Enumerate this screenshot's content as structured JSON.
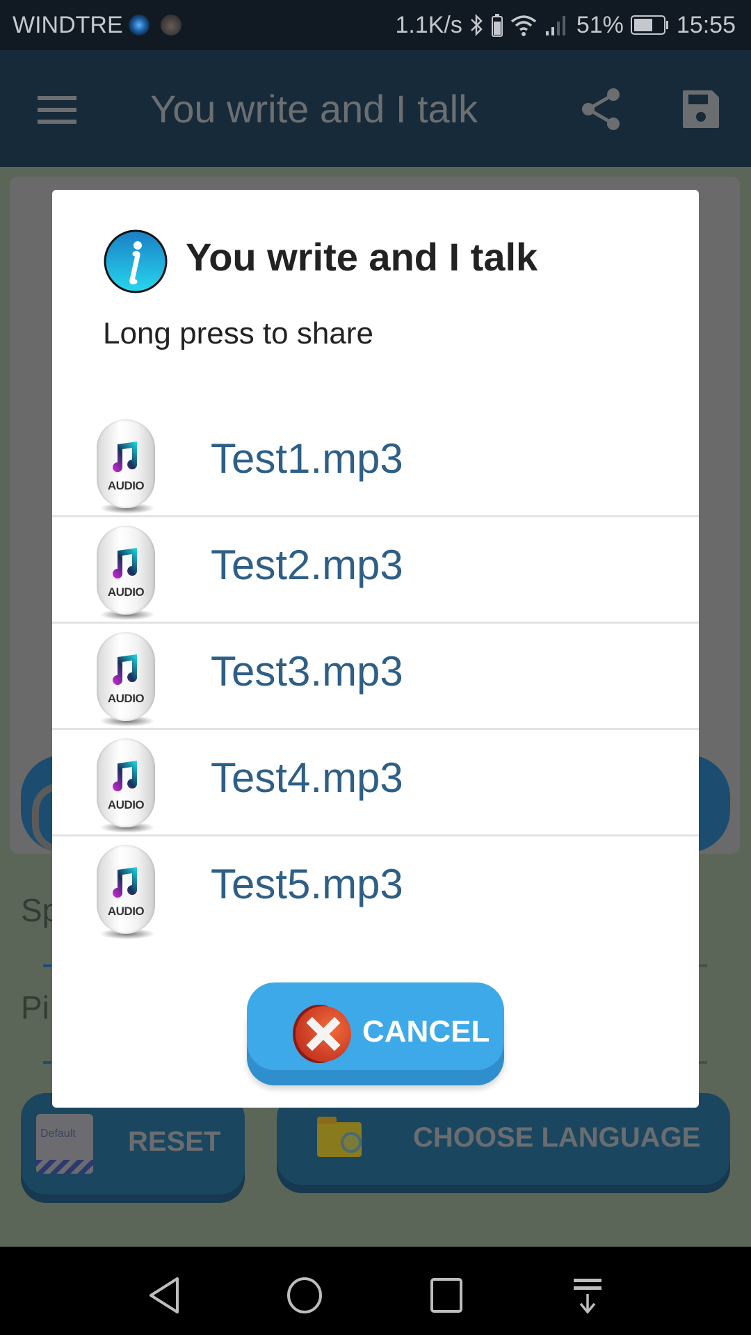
{
  "status_bar": {
    "carrier": "WINDTRE",
    "notification_icons": [
      "vpn-app-icon",
      "gorilla-app-icon"
    ],
    "network_speed": "1.1K/s",
    "battery_percent": "51%",
    "time": "15:55"
  },
  "app_bar": {
    "title": "You write and I talk",
    "icons": [
      "menu-icon",
      "share-icon",
      "save-icon"
    ]
  },
  "background": {
    "labels": [
      "Sp",
      "Pi"
    ],
    "reset_label": "RESET",
    "reset_icon_text": "Default",
    "choose_language_label": "CHOOSE LANGUAGE"
  },
  "dialog": {
    "title": "You write and I talk",
    "message": "Long press to share",
    "icon": "info-icon",
    "files": [
      {
        "name": "Test1.mp3",
        "icon_label": "AUDIO"
      },
      {
        "name": "Test2.mp3",
        "icon_label": "AUDIO"
      },
      {
        "name": "Test3.mp3",
        "icon_label": "AUDIO"
      },
      {
        "name": "Test4.mp3",
        "icon_label": "AUDIO"
      },
      {
        "name": "Test5.mp3",
        "icon_label": "AUDIO"
      }
    ],
    "cancel_label": "CANCEL"
  },
  "colors": {
    "app_bar": "#162a3a",
    "file_name_text": "#2e5f86",
    "cancel_button": "#3ea9e8",
    "cancel_icon": "#d9442a"
  },
  "nav_bar": {
    "buttons": [
      "back",
      "home",
      "recents",
      "notifications-pull"
    ]
  }
}
